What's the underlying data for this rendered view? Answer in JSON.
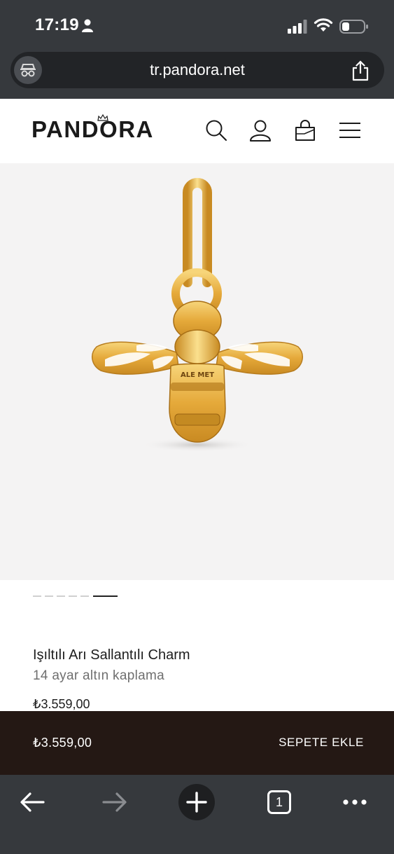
{
  "status_bar": {
    "time": "17:19",
    "icons": [
      "person-icon",
      "signal-icon",
      "wifi-icon",
      "battery-icon"
    ]
  },
  "browser": {
    "url": "tr.pandora.net",
    "site_icon": "incognito-glasses-icon",
    "share_icon": "share-icon",
    "toolbar": {
      "tab_count": "1",
      "icons": [
        "back-arrow-icon",
        "forward-arrow-icon",
        "plus-icon",
        "tabs-icon",
        "more-dots-icon"
      ]
    }
  },
  "site_header": {
    "logo": "PANDORA",
    "icons": [
      "search-icon",
      "account-icon",
      "shopping-bag-icon",
      "hamburger-menu-icon"
    ]
  },
  "product": {
    "image_alt": "bee charm",
    "image_engraving": "ALE MET",
    "carousel": {
      "count": 6,
      "active_index": 5
    },
    "title": "Işıltılı Arı Sallantılı Charm",
    "subtitle": "14 ayar altın kaplama",
    "price": "₺3.559,00"
  },
  "sticky_cart": {
    "price": "₺3.559,00",
    "button_label": "SEPETE EKLE"
  },
  "colors": {
    "browser_chrome": "#36393d",
    "url_bar": "#222427",
    "sticky_bar": "#241814",
    "image_bg": "#f4f3f3",
    "gold": "#e8b64c"
  }
}
